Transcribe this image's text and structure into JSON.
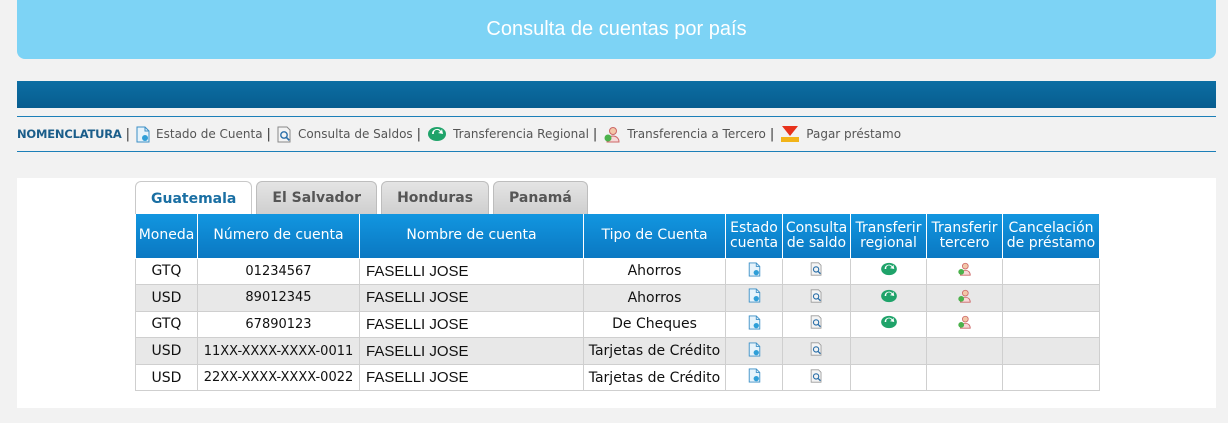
{
  "title": "Consulta de cuentas por país",
  "legend": {
    "title": "NOMENCLATURA",
    "items": [
      {
        "label": "Estado de Cuenta",
        "icon": "statement-icon"
      },
      {
        "label": "Consulta de Saldos",
        "icon": "balance-inquiry-icon"
      },
      {
        "label": "Transferencia Regional",
        "icon": "regional-transfer-icon"
      },
      {
        "label": "Transferencia a Tercero",
        "icon": "third-party-transfer-icon"
      },
      {
        "label": "Pagar préstamo",
        "icon": "pay-loan-icon"
      }
    ]
  },
  "tabs": [
    {
      "label": "Guatemala",
      "active": true
    },
    {
      "label": "El Salvador",
      "active": false
    },
    {
      "label": "Honduras",
      "active": false
    },
    {
      "label": "Panamá",
      "active": false
    }
  ],
  "table": {
    "headers": {
      "currency": "Moneda",
      "account_number": "Número de cuenta",
      "account_name": "Nombre de cuenta",
      "account_type": "Tipo de Cuenta",
      "statement_l1": "Estado",
      "statement_l2": "cuenta",
      "balance_l1": "Consulta",
      "balance_l2": "de saldo",
      "regional_l1": "Transferir",
      "regional_l2": "regional",
      "third_l1": "Transferir",
      "third_l2": "tercero",
      "loan_l1": "Cancelación",
      "loan_l2": "de préstamo"
    },
    "rows": [
      {
        "currency": "GTQ",
        "number": "01234567",
        "name": "FASELLI JOSE",
        "type": "Ahorros",
        "statement": true,
        "balance": true,
        "regional": true,
        "third": true
      },
      {
        "currency": "USD",
        "number": "89012345",
        "name": "FASELLI JOSE",
        "type": "Ahorros",
        "statement": true,
        "balance": true,
        "regional": true,
        "third": true
      },
      {
        "currency": "GTQ",
        "number": "67890123",
        "name": "FASELLI JOSE",
        "type": "De Cheques",
        "statement": true,
        "balance": true,
        "regional": true,
        "third": true
      },
      {
        "currency": "USD",
        "number": "11XX-XXXX-XXXX-0011",
        "name": "FASELLI JOSE",
        "type": "Tarjetas de Crédito",
        "statement": true,
        "balance": true,
        "regional": false,
        "third": false
      },
      {
        "currency": "USD",
        "number": "22XX-XXXX-XXXX-0022",
        "name": "FASELLI JOSE",
        "type": "Tarjetas de Crédito",
        "statement": true,
        "balance": true,
        "regional": false,
        "third": false
      }
    ]
  },
  "colors": {
    "title_bar": "#7dd3f5",
    "dark_band": "#0a6a9f",
    "table_header": "#0a86d3",
    "active_tab_text": "#1a6fa3"
  }
}
